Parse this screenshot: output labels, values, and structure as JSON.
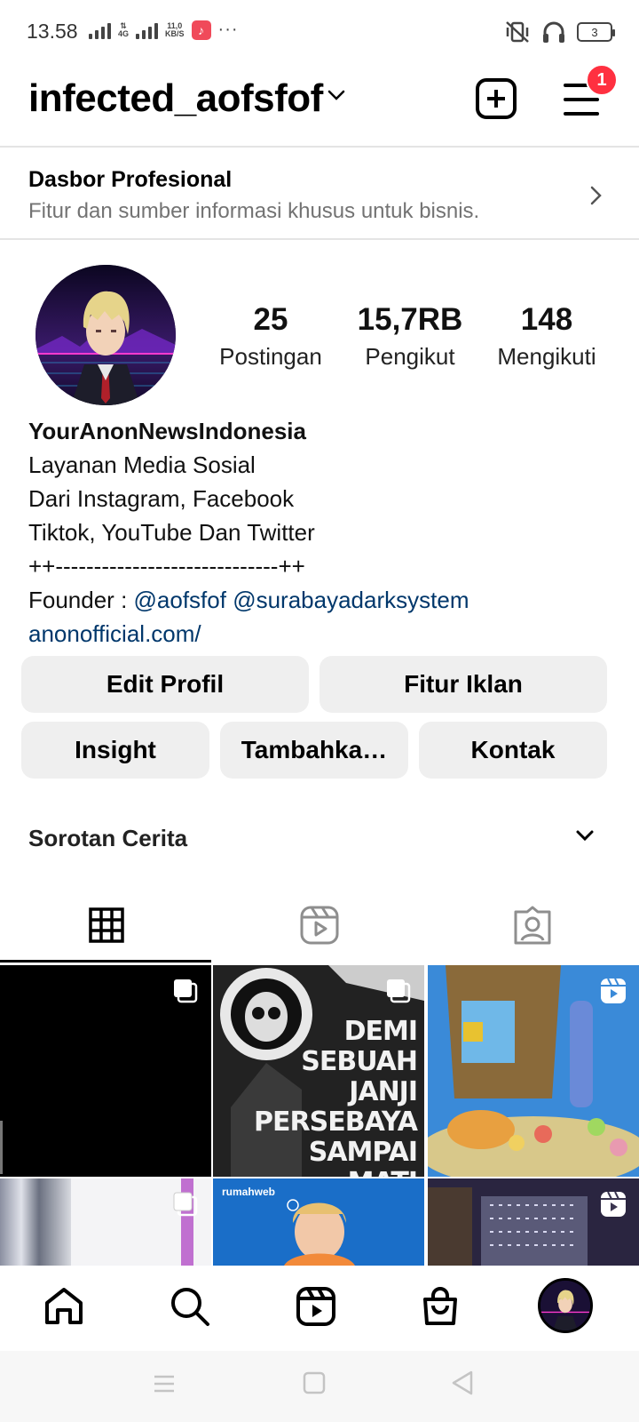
{
  "status_bar": {
    "time": "13.58",
    "network_type": "4G",
    "speed": "11,0",
    "speed_unit": "KB/S",
    "dots": "···",
    "battery": "3"
  },
  "header": {
    "username": "infected_aofsfof",
    "notification_count": "1"
  },
  "dashboard": {
    "title": "Dasbor Profesional",
    "subtitle": "Fitur dan sumber informasi khusus untuk bisnis."
  },
  "stats": [
    {
      "value": "25",
      "label": "Postingan"
    },
    {
      "value": "15,7RB",
      "label": "Pengikut"
    },
    {
      "value": "148",
      "label": "Mengikuti"
    }
  ],
  "bio": {
    "name": "YourAnonNewsIndonesia",
    "line1": "Layanan Media Sosial",
    "line2": "Dari Instagram, Facebook",
    "line3": "Tiktok, YouTube Dan Twitter",
    "line4": "++-----------------------------++",
    "founder_prefix": "Founder : ",
    "founder_link1": "@aofsfof",
    "founder_link2": "@surabayadarksystem",
    "website": "anonofficial.com/"
  },
  "buttons": {
    "edit_profile": "Edit Profil",
    "ad_tools": "Fitur Iklan",
    "insight": "Insight",
    "add": "Tambahka…",
    "contact": "Kontak"
  },
  "highlights": {
    "label": "Sorotan Cerita"
  },
  "posts": [
    {
      "type": "carousel"
    },
    {
      "type": "carousel",
      "text": [
        "DEMI",
        "SEBUAH",
        "JANJI",
        "PERSEBAYA",
        "SAMPAI",
        "MATI"
      ]
    },
    {
      "type": "reel"
    },
    {
      "type": "carousel"
    },
    {
      "type": "image",
      "brand": "rumahweb"
    },
    {
      "type": "reel"
    }
  ],
  "colors": {
    "link": "#00376b",
    "badge": "#ff3040",
    "button_bg": "#efefef"
  }
}
